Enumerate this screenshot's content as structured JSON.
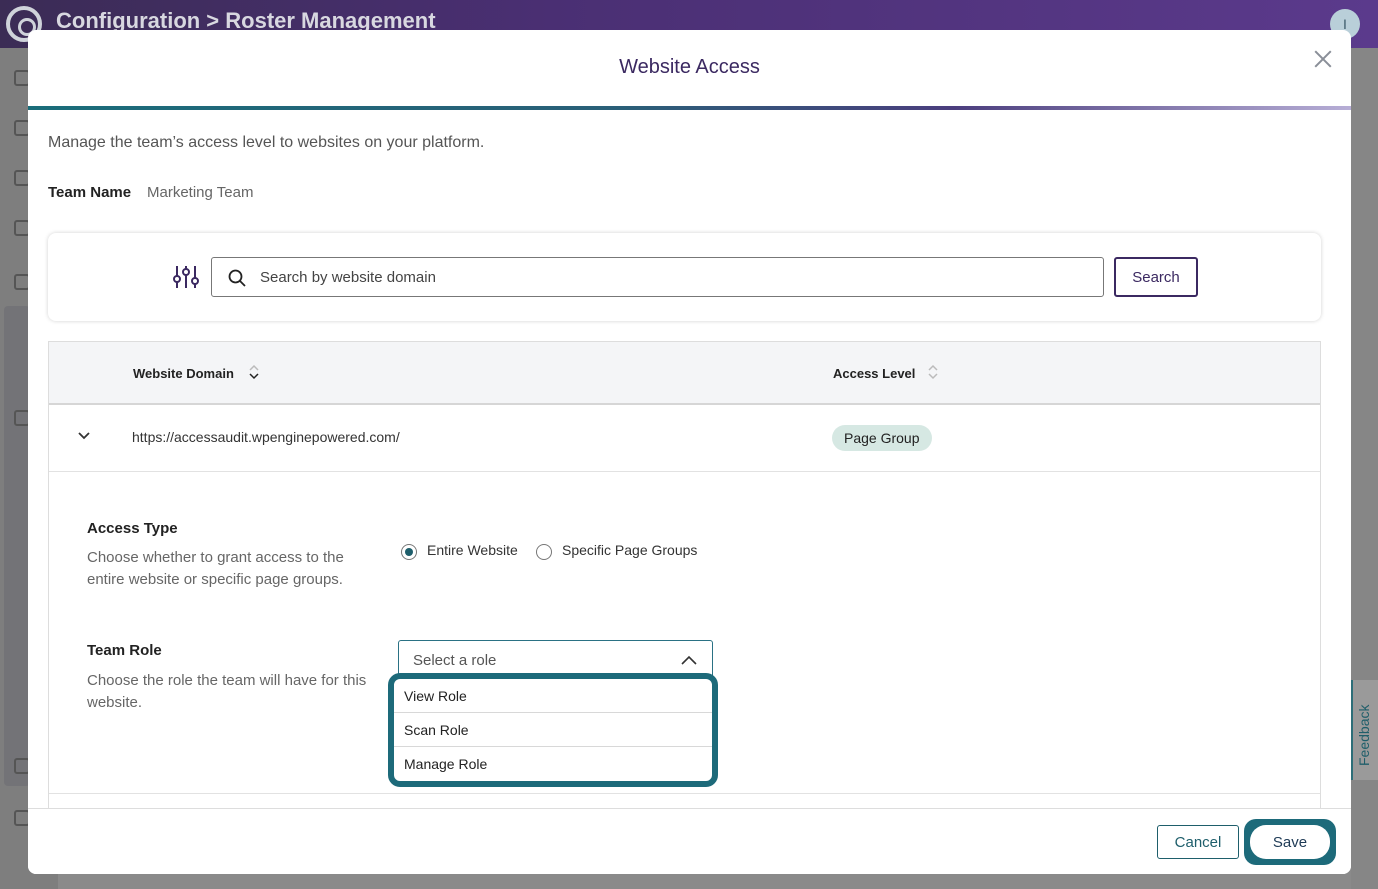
{
  "app": {
    "title": "Configuration > Roster Management",
    "avatar_initial": "I",
    "feedback_label": "Feedback"
  },
  "modal": {
    "title": "Website Access",
    "description": "Manage the team’s access level to websites on your platform.",
    "team_label": "Team Name",
    "team_value": "Marketing Team"
  },
  "search": {
    "placeholder": "Search by website domain",
    "value": "",
    "button_label": "Search"
  },
  "table": {
    "columns": [
      "Website Domain",
      "Access Level"
    ],
    "rows": [
      {
        "domain": "https://accessaudit.wpenginepowered.com/",
        "access_level": "Page Group"
      }
    ]
  },
  "access_type": {
    "title": "Access Type",
    "description": "Choose whether to grant access to the entire website or specific page groups.",
    "options": [
      "Entire Website",
      "Specific Page Groups"
    ],
    "selected": "Entire Website"
  },
  "team_role": {
    "title": "Team Role",
    "description": "Choose the role the team will have for this website.",
    "placeholder": "Select a role",
    "options": [
      "View Role",
      "Scan Role",
      "Manage Role"
    ]
  },
  "footer": {
    "cancel_label": "Cancel",
    "save_label": "Save"
  },
  "colors": {
    "brand_purple": "#3b2961",
    "accent_teal": "#1d6a7a",
    "badge_bg": "#d6e8e3"
  },
  "icons": {
    "filter": "sliders-icon",
    "search": "search-icon",
    "close": "close-icon",
    "sort": "sort-icon",
    "expand": "chevron-down-icon",
    "caret": "chevron-up-icon"
  }
}
